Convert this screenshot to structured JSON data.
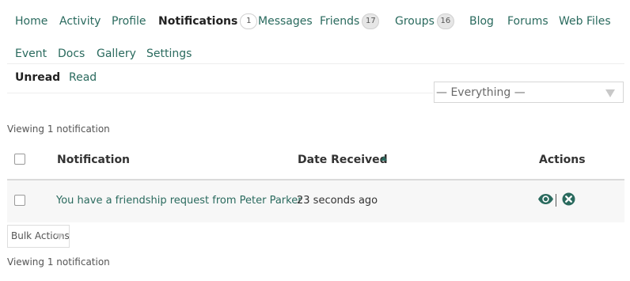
{
  "nav": {
    "home": "Home",
    "activity": "Activity",
    "profile": "Profile",
    "notifications": "Notifications",
    "notifications_count": "1",
    "messages": "Messages",
    "friends": "Friends",
    "friends_count": "17",
    "groups": "Groups",
    "groups_count": "16",
    "blog": "Blog",
    "forums": "Forums",
    "web_files": "Web Files",
    "event": "Event",
    "docs": "Docs",
    "gallery": "Gallery",
    "settings": "Settings"
  },
  "subnav": {
    "unread": "Unread",
    "read": "Read"
  },
  "filter": {
    "selected": "— Everything —"
  },
  "viewing_top": "Viewing 1 notification",
  "viewing_bottom": "Viewing 1 notification",
  "table": {
    "col_notification": "Notification",
    "col_date": "Date Received",
    "col_actions": "Actions",
    "rows": [
      {
        "text": "You have a friendship request from Peter Parker",
        "date": "23 seconds ago"
      }
    ]
  },
  "bulk_actions": {
    "selected": "Bulk Actions"
  },
  "colors": {
    "accent": "#2a6a5e",
    "row_bg": "#f7f7f7"
  },
  "icons": {
    "view": "eye-icon",
    "delete": "close-circle-icon",
    "sort": "sort-ascending-icon"
  }
}
